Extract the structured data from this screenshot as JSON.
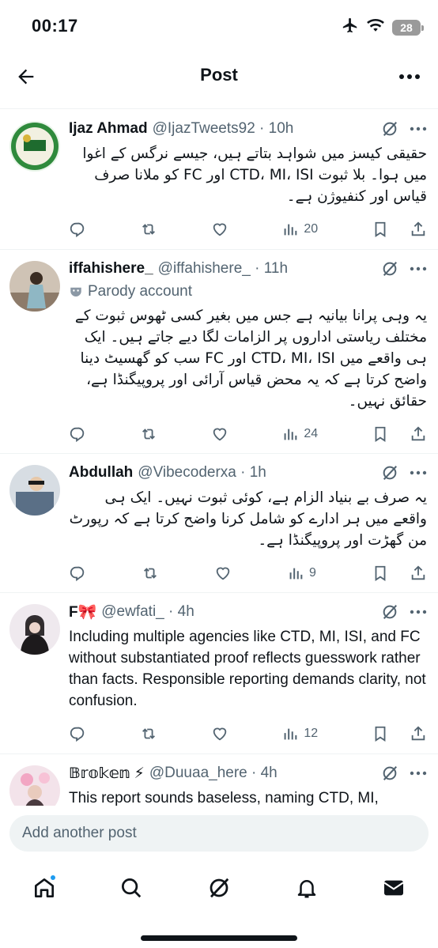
{
  "status_bar": {
    "time": "00:17",
    "battery": "28"
  },
  "header": {
    "title": "Post"
  },
  "posts": [
    {
      "name": "Ijaz Ahmad",
      "handle": "@IjazTweets92 · 10h",
      "text": "حقیقی کیسز میں شواہد بتاتے ہیں، جیسے نرگس کے اغوا میں ہوا۔ بلا ثبوت CTD، MI، ISI اور FC کو ملانا صرف قیاس اور کنفیوژن ہے۔",
      "views": "20"
    },
    {
      "name": "iffahishere_",
      "handle": "@iffahishere_ · 11h",
      "parody": "Parody account",
      "text": "یہ وہی پرانا بیانیہ ہے جس میں بغیر کسی ٹھوس ثبوت کے مختلف ریاستی اداروں پر الزامات لگا دیے جاتے ہیں۔ ایک ہی واقعے میں CTD، MI، ISI اور FC سب کو گھسیٹ دینا واضح کرتا ہے کہ یہ محض قیاس آرائی اور پروپیگنڈا ہے، حقائق نہیں۔",
      "views": "24"
    },
    {
      "name": "Abdullah",
      "handle": "@Vibecoderxa · 1h",
      "text": "یہ صرف بے بنیاد الزام ہے، کوئی ثبوت نہیں۔ ایک ہی واقعے میں ہر ادارے کو شامل کرنا واضح کرتا ہے کہ رپورٹ من گھڑت اور پروپیگنڈا ہے۔",
      "views": "9"
    },
    {
      "name": "F🎀",
      "handle": "@ewfati_ · 4h",
      "text": "Including multiple agencies like CTD, MI, ISI, and FC without substantiated proof reflects guesswork rather than facts. Responsible reporting demands clarity, not confusion.",
      "views": "12"
    },
    {
      "name": "𝔹𝕣𝕠𝕜𝕖𝕟 ⚡",
      "handle": "@Duuaa_here · 4h",
      "text": "This report sounds baseless, naming CTD, MI,",
      "views": ""
    }
  ],
  "compose": {
    "placeholder": "Add another post"
  },
  "icons": {
    "back": "arrow-left-icon",
    "more": "more-horizontal-icon",
    "reply": "reply-icon",
    "repost": "repost-icon",
    "like": "heart-icon",
    "views": "bar-chart-icon",
    "bookmark": "bookmark-icon",
    "share": "share-icon",
    "grok": "grok-icon",
    "tabs": [
      "home-icon",
      "search-icon",
      "grok-icon",
      "bell-icon",
      "mail-icon"
    ]
  },
  "colors": {
    "accent": "#1d9bf0",
    "muted": "#536471",
    "text": "#0f1419"
  }
}
